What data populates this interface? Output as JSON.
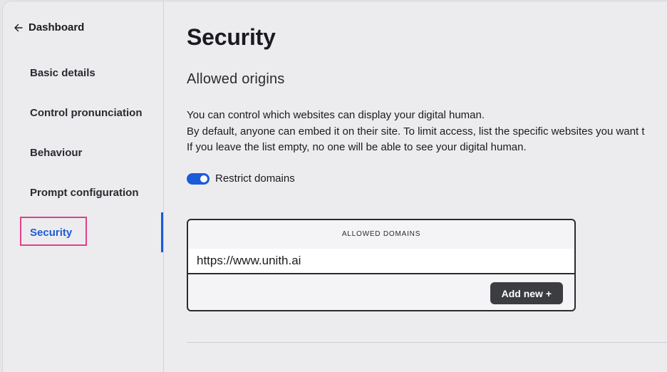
{
  "sidebar": {
    "back_label": "Dashboard",
    "items": [
      {
        "label": "Basic details"
      },
      {
        "label": "Control pronunciation"
      },
      {
        "label": "Behaviour"
      },
      {
        "label": "Prompt configuration"
      },
      {
        "label": "Security"
      }
    ],
    "active_item": "Security"
  },
  "main": {
    "title": "Security",
    "section_title": "Allowed origins",
    "description": [
      "You can control which websites can display your digital human.",
      "By default, anyone can embed it on their site. To limit access, list the specific websites you want t",
      "If you leave the list empty, no one will be able to see your digital human."
    ],
    "restrict_toggle": {
      "label": "Restrict domains",
      "enabled": true
    },
    "domains": {
      "header": "ALLOWED DOMAINS",
      "input_value": "https://www.unith.ai",
      "add_label": "Add new +"
    }
  },
  "colors": {
    "accent": "#1a5bd8",
    "highlight": "#e23f8c",
    "button_bg": "#3c3d40"
  }
}
